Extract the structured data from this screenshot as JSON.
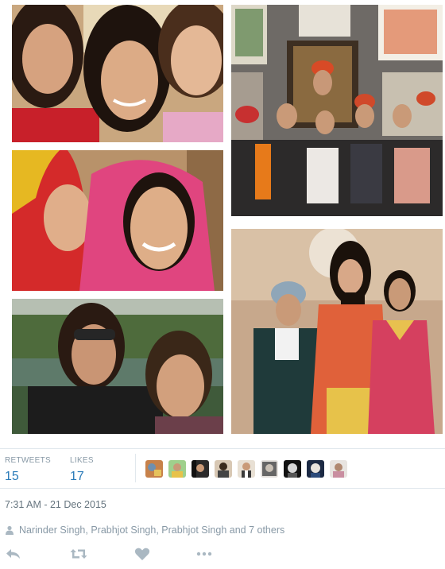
{
  "tweet": {
    "stats": {
      "retweets_label": "RETWEETS",
      "retweets_count": "15",
      "likes_label": "LIKES",
      "likes_count": "17"
    },
    "timestamp": "7:31 AM - 21 Dec 2015",
    "liked_by": "Narinder Singh, Prabhjot Singh, Prabhjot Singh and 7 others",
    "actions": [
      "reply-icon",
      "retweet-icon",
      "like-heart-icon",
      "more-dots-icon"
    ],
    "colors": {
      "count_blue": "#2b7bb9",
      "label_grey": "#8899a6",
      "icon_grey": "#aab8c2",
      "divider": "#e1e8ed"
    }
  }
}
